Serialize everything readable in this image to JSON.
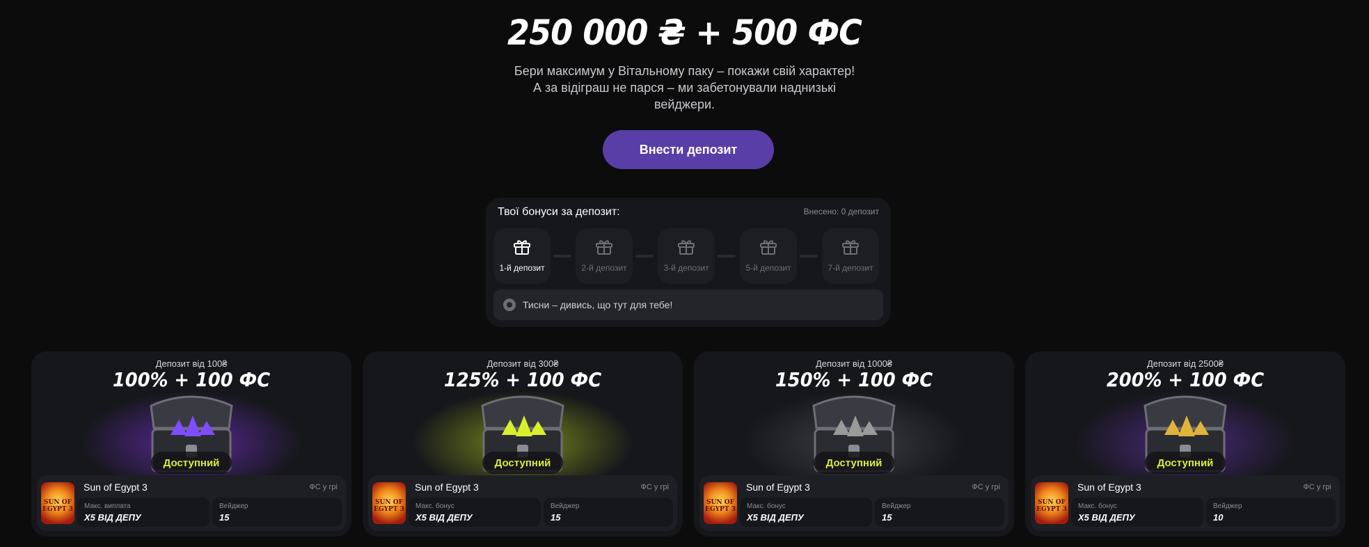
{
  "hero": {
    "title": "250 000 ₴ + 500 ФС",
    "subtitle_line1": "Бери максимум у Вітальному паку – покажи свій характер!",
    "subtitle_line2": "А за відіграш не парся – ми забетонували наднизькі",
    "subtitle_line3": "вейджери.",
    "deposit_button": "Внести депозит"
  },
  "bonus_panel": {
    "title": "Твої бонуси за депозит:",
    "counter": "Внесено: 0 депозит",
    "steps": [
      {
        "label": "1-й депозит",
        "active": true,
        "icon": "gift-icon"
      },
      {
        "label": "2-й депозит",
        "active": false,
        "icon": "gift-icon"
      },
      {
        "label": "3-й депозит",
        "active": false,
        "icon": "gift-icon"
      },
      {
        "label": "5-й депозит",
        "active": false,
        "icon": "gift-icon"
      },
      {
        "label": "7-й депозит",
        "active": false,
        "icon": "gift-icon"
      }
    ],
    "hint": "Тисни – дивись, що тут для тебе!",
    "hint_icon": "info-icon"
  },
  "cards": [
    {
      "deposit_from": "Депозит від 100₴",
      "offer": "100% + 100 ФС",
      "status": "Доступний",
      "game": "Sun of Egypt 3",
      "game_icon_text": "SUN OF EGYPT 3",
      "fs_note": "ФС у грі",
      "box1_label": "Макс. виплата",
      "box1_value": "X5 ВІД ДЕПУ",
      "box2_label": "Вейджер",
      "box2_value": "15",
      "glow_color": "#5a2a9c",
      "gem_color": "#7d4dff"
    },
    {
      "deposit_from": "Депозит від 300₴",
      "offer": "125% + 100 ФС",
      "status": "Доступний",
      "game": "Sun of Egypt 3",
      "game_icon_text": "SUN OF EGYPT 3",
      "fs_note": "ФС у грі",
      "box1_label": "Макс. бонус",
      "box1_value": "X5 ВІД ДЕПУ",
      "box2_label": "Вейджер",
      "box2_value": "15",
      "glow_color": "#7a8a1c",
      "gem_color": "#d8ef2c"
    },
    {
      "deposit_from": "Депозит від 1000₴",
      "offer": "150% + 100 ФС",
      "status": "Доступний",
      "game": "Sun of Egypt 3",
      "game_icon_text": "SUN OF EGYPT 3",
      "fs_note": "ФС у грі",
      "box1_label": "Макс. бонус",
      "box1_value": "X5 ВІД ДЕПУ",
      "box2_label": "Вейджер",
      "box2_value": "15",
      "glow_color": "#3d3e44",
      "gem_color": "#9a9a9a"
    },
    {
      "deposit_from": "Депозит від 2500₴",
      "offer": "200% + 100 ФС",
      "status": "Доступний",
      "game": "Sun of Egypt 3",
      "game_icon_text": "SUN OF EGYPT 3",
      "fs_note": "ФС у грі",
      "box1_label": "Макс. бонус",
      "box1_value": "X5 ВІД ДЕПУ",
      "box2_label": "Вейджер",
      "box2_value": "10",
      "glow_color": "#4a2a7c",
      "gem_color": "#e0b43a"
    }
  ]
}
